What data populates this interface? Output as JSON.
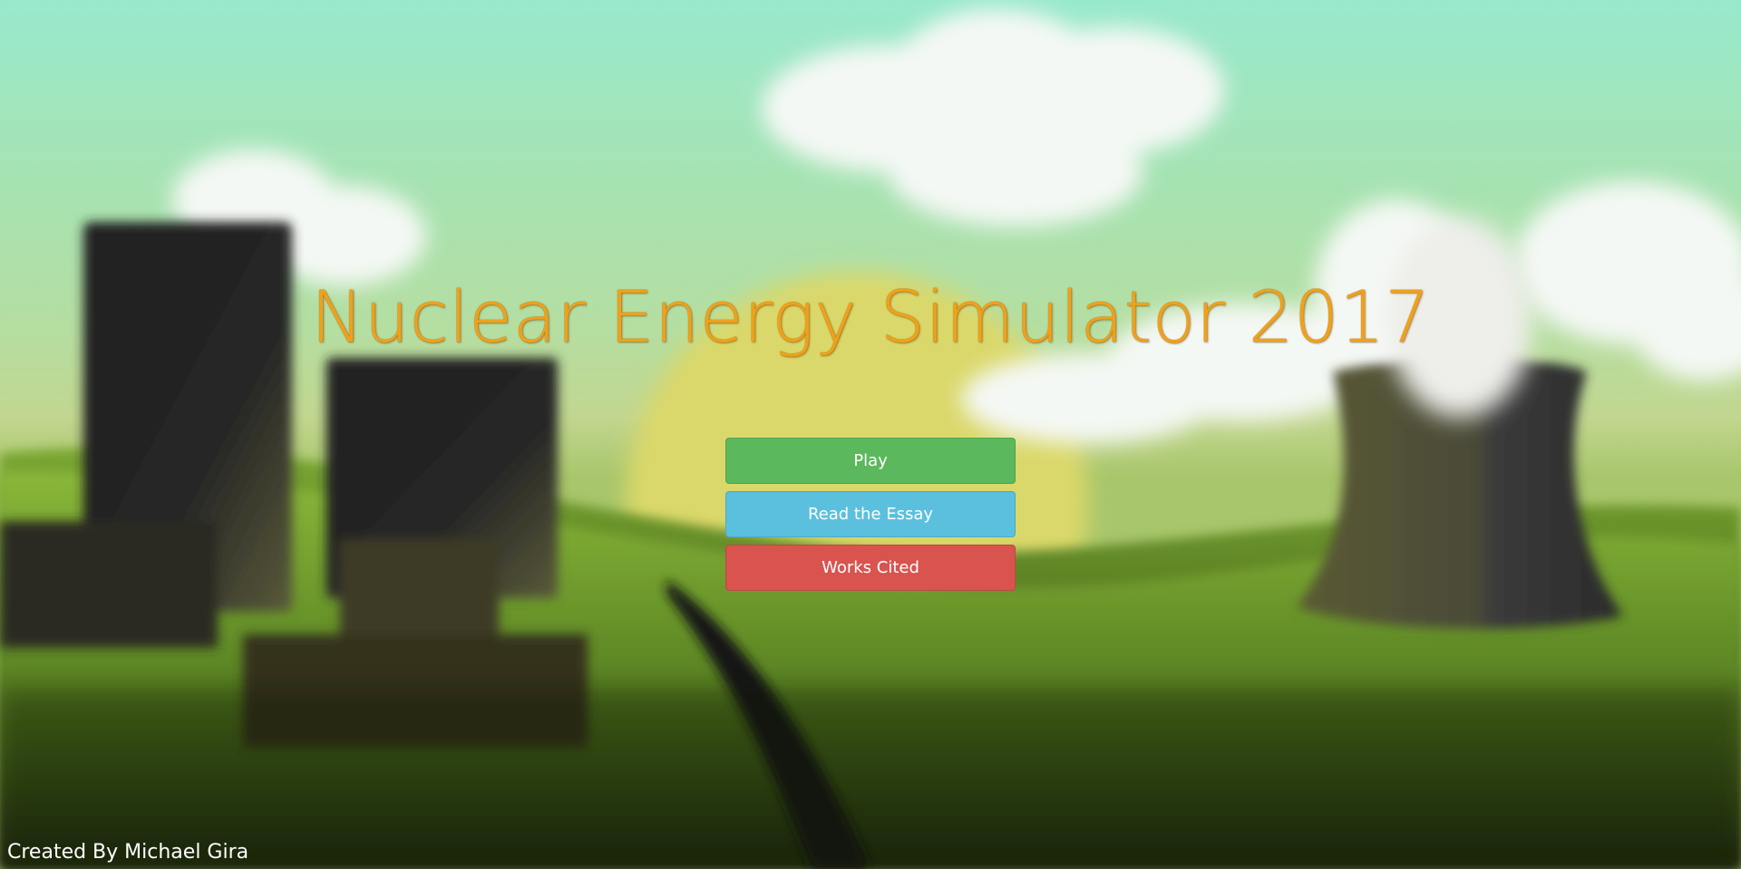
{
  "title": "Nuclear Energy Simulator 2017",
  "menu": {
    "play_label": "Play",
    "essay_label": "Read the Essay",
    "cited_label": "Works Cited"
  },
  "footer": {
    "credit": "Created By Michael Gira"
  },
  "colors": {
    "title": "#f0a11a",
    "play": "#5cb85c",
    "essay": "#5bc0de",
    "cited": "#d9534f"
  }
}
